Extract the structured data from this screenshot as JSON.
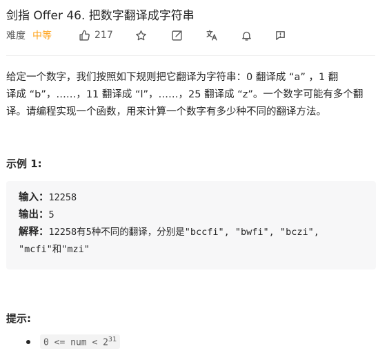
{
  "problem": {
    "title": "剑指 Offer 46. 把数字翻译成字符串",
    "difficulty_label": "难度",
    "difficulty": "中等",
    "like_count": "217"
  },
  "icons": {
    "like": "thumbs-up-icon",
    "star": "star-icon",
    "share": "share-icon",
    "lang": "translate-icon",
    "bell": "bell-icon",
    "feedback": "feedback-icon"
  },
  "description": {
    "lines": [
      "给定一个数字，我们按照如下规则把它翻译为字符串：0 翻译成 “a” ，1 翻",
      "译成 “b”，……，11 翻译成 “l”，……，25 翻译成 “z”。一个数字可能有多个翻",
      "译。请编程实现一个函数，用来计算一个数字有多少种不同的翻译方法。"
    ]
  },
  "example": {
    "title": "示例 1:",
    "input_label": "输入：",
    "input_value": "12258",
    "output_label": "输出：",
    "output_value": "5",
    "explain_label": "解释：",
    "explain_line1": "12258有5种不同的翻译，分别是\"bccfi\", \"bwfi\", \"bczi\",",
    "explain_line2": "\"mcfi\"和\"mzi\""
  },
  "hints": {
    "title": "提示:",
    "constraint_prefix": "0 <= num < 2",
    "constraint_exp": "31"
  }
}
